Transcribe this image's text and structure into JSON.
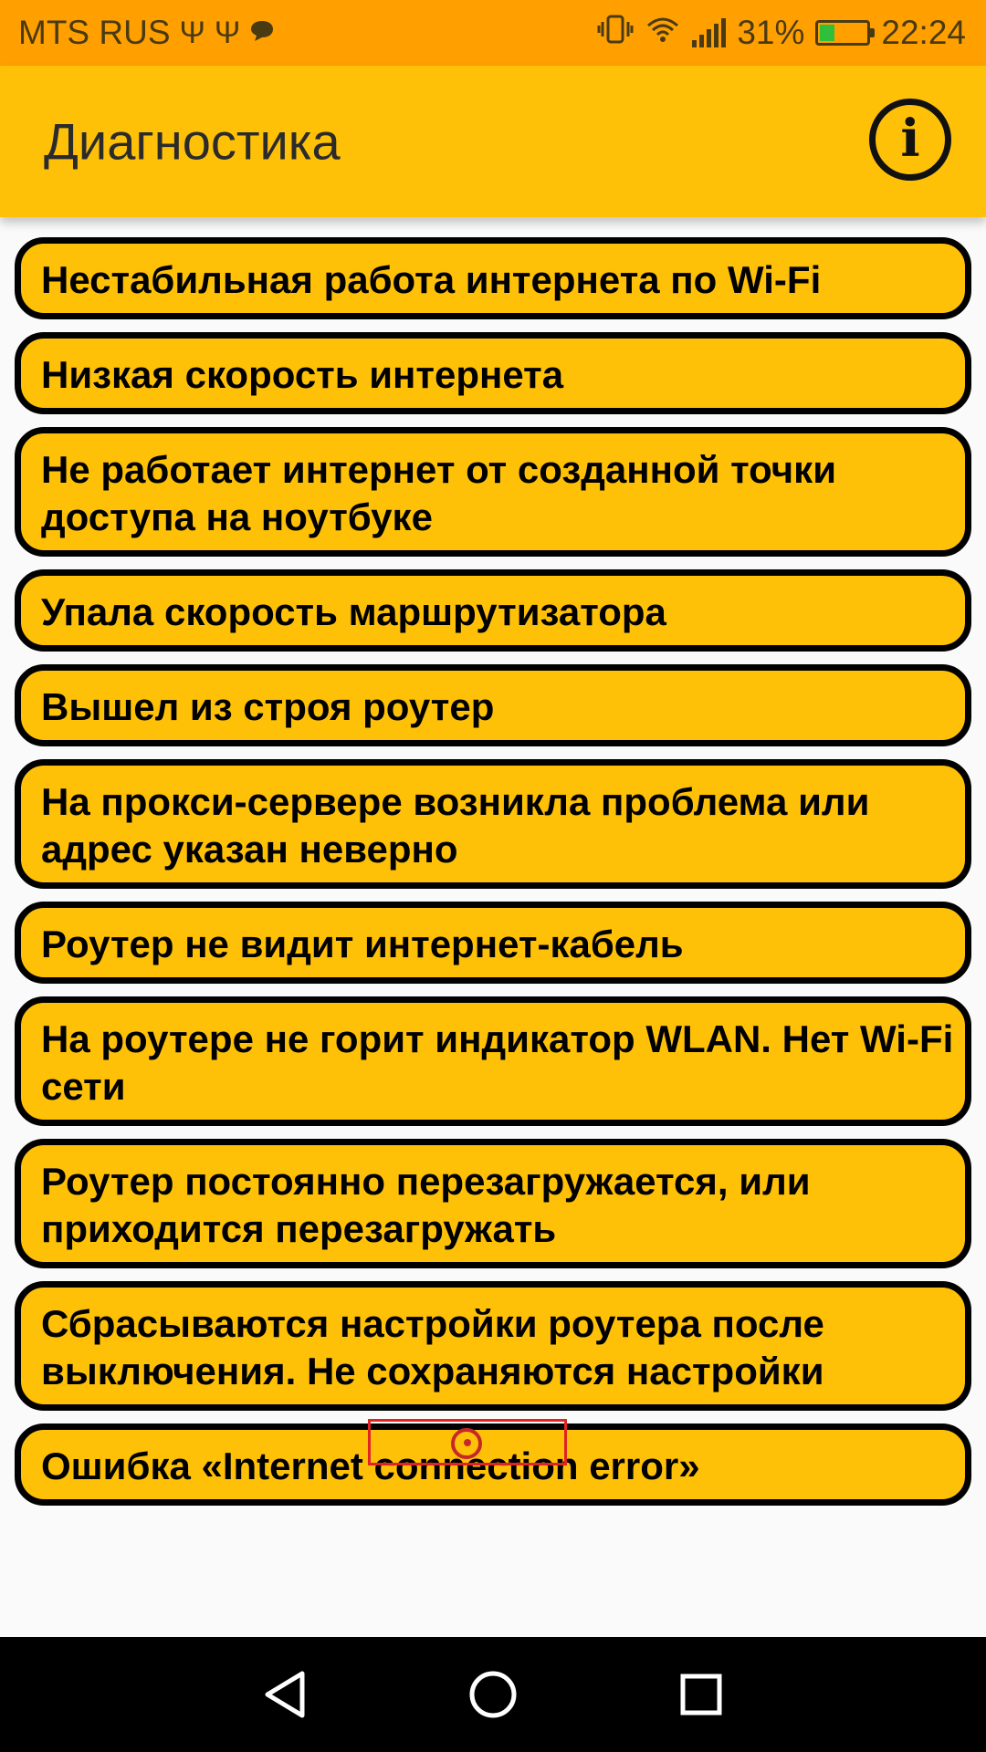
{
  "status_bar": {
    "carrier": "MTS RUS",
    "battery_percent": "31%",
    "battery_level": 0.31,
    "time": "22:24",
    "icons": [
      "usb-icon",
      "usb-icon",
      "chat-icon",
      "vibrate-icon",
      "wifi-icon",
      "signal-icon",
      "battery-charging-icon"
    ]
  },
  "app_bar": {
    "title": "Диагностика",
    "info_icon": "info-icon",
    "background_color": "#ffc107"
  },
  "items": [
    {
      "label": "Нестабильная работа интернета по Wi-Fi"
    },
    {
      "label": "Низкая скорость интернета"
    },
    {
      "label": "Не работает интернет от созданной точки доступа на ноутбуке"
    },
    {
      "label": "Упала скорость маршрутизатора"
    },
    {
      "label": "Вышел из строя роутер"
    },
    {
      "label": "На прокси-сервере возникла проблема или адрес указан неверно"
    },
    {
      "label": "Роутер не видит интернет-кабель"
    },
    {
      "label": "На роутере не горит индикатор WLAN. Нет Wi-Fi сети"
    },
    {
      "label": "Роутер постоянно перезагружается, или приходится перезагружать"
    },
    {
      "label": "Сбрасываются настройки роутера после выключения. Не сохраняются настройки"
    },
    {
      "label": "Ошибка «Internet connection error»"
    }
  ],
  "nav_bar": {
    "buttons": [
      "back-icon",
      "home-icon",
      "recents-icon"
    ]
  },
  "colors": {
    "status_bar": "#ffa000",
    "item_fill": "#ffc107",
    "item_border": "#000000",
    "background": "#fafafa"
  }
}
